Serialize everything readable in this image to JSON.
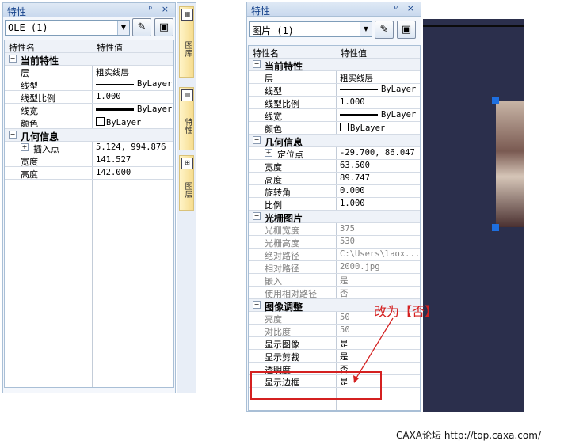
{
  "left_panel": {
    "title": "特性",
    "title_buttons": "ᵖ ×",
    "combo_value": "OLE (1)",
    "header": {
      "name": "特性名",
      "value": "特性值"
    },
    "rows": [
      {
        "type": "cat",
        "name": "当前特性",
        "box": "−"
      },
      {
        "name": "层",
        "value": "粗实线层"
      },
      {
        "name": "线型",
        "value": "ByLayer",
        "line": "thin"
      },
      {
        "name": "线型比例",
        "value": "1.000"
      },
      {
        "name": "线宽",
        "value": "ByLayer",
        "line": "thick"
      },
      {
        "name": "颜色",
        "value": "ByLayer",
        "swatch": true
      },
      {
        "type": "cat",
        "name": "几何信息",
        "box": "−"
      },
      {
        "name": "插入点",
        "value": "5.124, 994.876",
        "box": "+"
      },
      {
        "name": "宽度",
        "value": "141.527"
      },
      {
        "name": "高度",
        "value": "142.000"
      }
    ]
  },
  "side_tabs": [
    {
      "label": "图库",
      "icon": "▦"
    },
    {
      "label": "特性",
      "icon": "▤"
    },
    {
      "label": "图层",
      "icon": "⊞"
    }
  ],
  "right_panel": {
    "title": "特性",
    "title_buttons": "ᵖ ×",
    "combo_value": "图片 (1)",
    "header": {
      "name": "特性名",
      "value": "特性值"
    },
    "rows": [
      {
        "type": "cat",
        "name": "当前特性",
        "box": "−"
      },
      {
        "name": "层",
        "value": "粗实线层"
      },
      {
        "name": "线型",
        "value": "ByLayer",
        "line": "thin"
      },
      {
        "name": "线型比例",
        "value": "1.000"
      },
      {
        "name": "线宽",
        "value": "ByLayer",
        "line": "thick"
      },
      {
        "name": "颜色",
        "value": "ByLayer",
        "swatch": true
      },
      {
        "type": "cat",
        "name": "几何信息",
        "box": "−"
      },
      {
        "name": "定位点",
        "value": "-29.700, 86.047",
        "box": "+"
      },
      {
        "name": "宽度",
        "value": "63.500"
      },
      {
        "name": "高度",
        "value": "89.747"
      },
      {
        "name": "旋转角",
        "value": "0.000"
      },
      {
        "name": "比例",
        "value": "1.000"
      },
      {
        "type": "cat",
        "name": "光栅图片",
        "box": "−"
      },
      {
        "name": "光栅宽度",
        "value": "375",
        "gray": true
      },
      {
        "name": "光栅高度",
        "value": "530",
        "gray": true
      },
      {
        "name": "绝对路径",
        "value": "C:\\Users\\laox...",
        "gray": true
      },
      {
        "name": "相对路径",
        "value": "2000.jpg",
        "gray": true
      },
      {
        "name": "嵌入",
        "value": "是",
        "gray": true
      },
      {
        "name": "使用相对路径",
        "value": "否",
        "gray": true
      },
      {
        "type": "cat",
        "name": "图像调整",
        "box": "−"
      },
      {
        "name": "亮度",
        "value": "50",
        "gray": true
      },
      {
        "name": "对比度",
        "value": "50",
        "gray": true
      },
      {
        "name": "显示图像",
        "value": "是"
      },
      {
        "name": "显示剪裁",
        "value": "是"
      },
      {
        "name": "透明度",
        "value": "否"
      },
      {
        "name": "显示边框",
        "value": "是"
      }
    ]
  },
  "annotation": "改为【否】",
  "footer": "CAXA论坛 http://top.caxa.com/",
  "colors": {
    "accent_red": "#d42020",
    "handle_blue": "#1e6fe0",
    "canvas_bg": "#2b2f4c"
  }
}
